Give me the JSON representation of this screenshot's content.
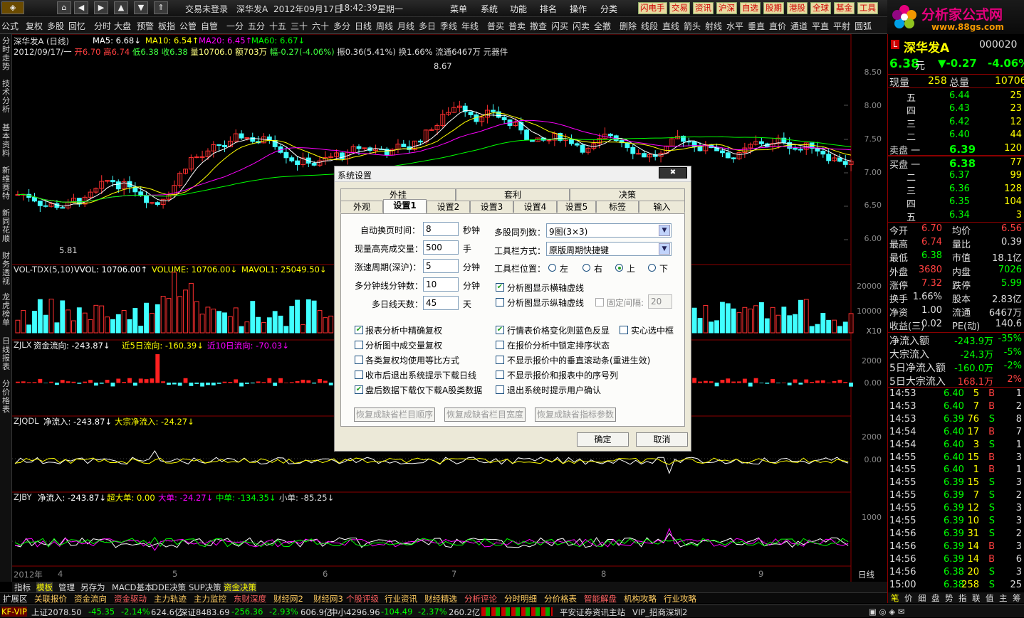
{
  "window": {
    "title_parts": [
      "交易未登录",
      "深华发A",
      "2012年09月17日",
      "18:42:39",
      "星期一"
    ],
    "menus": [
      "菜单",
      "系统",
      "功能",
      "排名",
      "操作",
      "分类"
    ],
    "quick_buttons": [
      "闪电手",
      "交易",
      "资讯",
      "沪深",
      "自选",
      "股期",
      "港股",
      "全球",
      "基金",
      "工具"
    ]
  },
  "logo": {
    "text": "分析家公式网",
    "url": "www.88gs.com"
  },
  "toolbar": [
    "公式",
    "复权",
    "多股",
    "回忆",
    "分时",
    "大盘",
    "预警",
    "板指",
    "公管",
    "自管",
    "一分",
    "五分",
    "十五",
    "三十",
    "六十",
    "多分",
    "日线",
    "周线",
    "月线",
    "多日",
    "季线",
    "年线",
    "普买",
    "普卖",
    "撤查",
    "闪买",
    "闪卖",
    "全撤",
    "删除",
    "线段",
    "直线",
    "箭头",
    "射线",
    "水平",
    "垂直",
    "直价",
    "通道",
    "平直",
    "平射",
    "圆弧"
  ],
  "leftbar": [
    "分时走势",
    "技术分析",
    "基本资料",
    "新维赛特",
    "新同花顺",
    "财务透视",
    "龙虎榜单",
    "日线报表",
    "分价格表"
  ],
  "chart": {
    "header1": "深华发A (日线) MA5: 6.68↓ MA10: 6.54↑ MA20: 6.45↑ MA60: 6.67↓",
    "header1_parts": {
      "name": "深华发A (日线)",
      "ma5": "MA5: 6.68↓",
      "ma10": "MA10: 6.54↑",
      "ma20": "MA20: 6.45↑",
      "ma60": "MA60: 6.67↓"
    },
    "header2_parts": {
      "date": "2012/09/17/一",
      "open": "开6.70",
      "high": "高6.74",
      "low": "低6.38",
      "close": "收6.38",
      "vol": "量10706.0",
      "amount": "额703万",
      "change": "幅-0.27(-4.06%)",
      "amp": "振0.36(5.41%)",
      "turnover": "换1.66%",
      "float": "流通6467万",
      "sector": "元器件"
    },
    "price_ticks": [
      "8.50",
      "8.00",
      "7.50",
      "7.00",
      "6.50",
      "6.00"
    ],
    "max_label": "8.67",
    "min_label": "5.81",
    "vol_header": {
      "name": "VOL-TDX(5,10)",
      "vvol": "VVOL: 10706.00↑",
      "volume": "VOLUME: 10706.00↓",
      "mavol": "MAVOL1: 25049.50↓"
    },
    "vol_ticks": [
      "20000",
      "10000"
    ],
    "vol_unit": "X10",
    "zjlx_header": {
      "name": "ZJLX",
      "a": "资金流向: -243.87↓",
      "b": "近5日流向: -160.39↓",
      "c": "近10日流向: -70.03↓"
    },
    "zjlx_ticks": [
      "2000",
      "0.00"
    ],
    "zjqdl_header": {
      "name": "ZJQDL",
      "a": "净流入: -243.87↓",
      "b": "大宗净流入: -24.27↓"
    },
    "zjqdl_ticks": [
      "2000",
      "0.00"
    ],
    "zjby_header": {
      "name": "ZJBY",
      "a": "净流入: -243.87↓",
      "b": "超大单: 0.00",
      "c": "大单: -24.27↓",
      "d": "中单: -134.35↓",
      "e": "小单: -85.25↓"
    },
    "zjby_ticks": [
      "1000"
    ],
    "xaxis": [
      "2012年",
      "4",
      "5",
      "6",
      "7",
      "8",
      "9"
    ],
    "period": "日线"
  },
  "quote": {
    "flag": "L",
    "name": "深华发A",
    "code": "000020",
    "price": "6.38",
    "unit": "元",
    "change": "▼-0.27",
    "pct": "-4.06%",
    "now_label": "现量",
    "now": "258",
    "total_label": "总量",
    "total": "10706",
    "sell": [
      {
        "l": "五",
        "p": "6.44",
        "v": "25"
      },
      {
        "l": "四",
        "p": "6.43",
        "v": "23"
      },
      {
        "l": "三",
        "p": "6.42",
        "v": "12"
      },
      {
        "l": "二",
        "p": "6.40",
        "v": "44"
      },
      {
        "l": "卖盘 一",
        "p": "6.39",
        "v": "120"
      }
    ],
    "buy": [
      {
        "l": "买盘 一",
        "p": "6.38",
        "v": "77"
      },
      {
        "l": "二",
        "p": "6.37",
        "v": "99"
      },
      {
        "l": "三",
        "p": "6.36",
        "v": "128"
      },
      {
        "l": "四",
        "p": "6.35",
        "v": "104"
      },
      {
        "l": "五",
        "p": "6.34",
        "v": "3"
      }
    ],
    "stats": [
      [
        "今开",
        "6.70",
        "均价",
        "6.56"
      ],
      [
        "最高",
        "6.74",
        "量比",
        "0.39"
      ],
      [
        "最低",
        "6.38",
        "市值",
        "18.1亿"
      ],
      [
        "外盘",
        "3680",
        "内盘",
        "7026"
      ],
      [
        "涨停",
        "7.32",
        "跌停",
        "5.99"
      ],
      [
        "换手",
        "1.66%",
        "股本",
        "2.83亿"
      ],
      [
        "净资",
        "1.00",
        "流通",
        "6467万"
      ],
      [
        "收益(三)",
        "0.02",
        "PE(动)",
        "140.6"
      ]
    ],
    "flows": [
      [
        "净流入额",
        "-243.9万",
        "-35%"
      ],
      [
        "大宗流入",
        "-24.3万",
        "-5%"
      ],
      [
        "5日净流入额",
        "-160.0万",
        "-2%"
      ],
      [
        "5日大宗流入",
        "168.1万",
        "2%"
      ]
    ],
    "ticks": [
      [
        "14:53",
        "6.40",
        "5",
        "B",
        "1"
      ],
      [
        "14:53",
        "6.40",
        "7",
        "B",
        "2"
      ],
      [
        "14:53",
        "6.39",
        "76",
        "S",
        "8"
      ],
      [
        "14:54",
        "6.40",
        "17",
        "B",
        "7"
      ],
      [
        "14:54",
        "6.40",
        "3",
        "S",
        "1"
      ],
      [
        "14:55",
        "6.40",
        "15",
        "B",
        "3"
      ],
      [
        "14:55",
        "6.40",
        "1",
        "B",
        "1"
      ],
      [
        "14:55",
        "6.39",
        "15",
        "S",
        "3"
      ],
      [
        "14:55",
        "6.39",
        "7",
        "S",
        "2"
      ],
      [
        "14:55",
        "6.39",
        "12",
        "S",
        "3"
      ],
      [
        "14:55",
        "6.39",
        "10",
        "S",
        "3"
      ],
      [
        "14:56",
        "6.39",
        "31",
        "S",
        "2"
      ],
      [
        "14:56",
        "6.39",
        "14",
        "B",
        "3"
      ],
      [
        "14:56",
        "6.39",
        "14",
        "B",
        "6"
      ],
      [
        "14:56",
        "6.38",
        "20",
        "S",
        "3"
      ],
      [
        "15:00",
        "6.38",
        "258",
        "S",
        "25"
      ]
    ],
    "bottom_tabs": [
      "笔",
      "价",
      "细",
      "盘",
      "势",
      "指",
      "联",
      "值",
      "主",
      "筹"
    ]
  },
  "dialog": {
    "title": "系统设置",
    "close": "✖",
    "tabs_row1": [
      "外挂",
      "套利",
      "决策"
    ],
    "tabs_row2": [
      "外观",
      "设置1",
      "设置2",
      "设置3",
      "设置4",
      "设置5",
      "标签",
      "输入"
    ],
    "fields": [
      {
        "label": "自动换页时间：",
        "value": "8",
        "unit": "秒钟"
      },
      {
        "label": "现量高亮成交量：",
        "value": "500",
        "unit": "手"
      },
      {
        "label": "涨速周期(深沪)：",
        "value": "5",
        "unit": "分钟"
      },
      {
        "label": "多分钟线分钟数：",
        "value": "10",
        "unit": "分钟"
      },
      {
        "label": "多日线天数：",
        "value": "45",
        "unit": "天"
      }
    ],
    "multi_label": "多股同列数：",
    "multi_value": "9图(3×3)",
    "tb_label": "工具栏方式：",
    "tb_value": "原版周期快捷键",
    "pos_label": "工具栏位置：",
    "pos_opts": [
      "左",
      "右",
      "上",
      "下"
    ],
    "chk_h": "分析图显示横轴虚线",
    "chk_v": "分析图显示纵轴虚线",
    "fixed_label": "固定间隔:",
    "fixed_value": "20",
    "left_checks": [
      {
        "t": "报表分析中精确复权",
        "c": true
      },
      {
        "t": "分析图中成交量复权",
        "c": false
      },
      {
        "t": "各类复权均使用等比方式",
        "c": false
      },
      {
        "t": "收市后退出系统提示下载日线",
        "c": false
      },
      {
        "t": "盘后数据下载仅下载A股类数据",
        "c": true
      }
    ],
    "right_checks": [
      {
        "t": "行情表价格变化则蓝色反显",
        "c": true
      },
      {
        "t": "在报价分析中锁定排序状态",
        "c": false
      },
      {
        "t": "不显示报价中的垂直滚动条(重进生效)",
        "c": false
      },
      {
        "t": "不显示报价和报表中的序号列",
        "c": false
      },
      {
        "t": "退出系统时提示用户确认",
        "c": false
      }
    ],
    "solid_check": "实心选中框",
    "restore_buttons": [
      "恢复成缺省栏目顺序",
      "恢复成缺省栏目宽度",
      "恢复成缺省指标参数"
    ],
    "ok": "确定",
    "cancel": "取消"
  },
  "bottom_tabs": [
    "指标",
    "模板",
    "管理",
    "另存为",
    "MACD基本",
    "DDE决策",
    "SUP决策",
    "资金决策"
  ],
  "categories": [
    "扩展区",
    "关联报价",
    "资金流向",
    "资金驱动",
    "主力轨迹",
    "主力监控",
    "东财深度",
    "财经网2",
    "财经网3",
    "个股评级",
    "行业资讯",
    "财经精选",
    "分析评论",
    "分时明细",
    "分价格表",
    "智能解盘",
    "机构攻略",
    "行业攻略"
  ],
  "status": {
    "vip": "KF-VIP",
    "sh": "上证2078.50",
    "sh_chg": "-45.35",
    "sh_pct": "-2.14%",
    "sh_amt": "624.6亿",
    "sz": "深证8483.69",
    "sz_chg": "-256.36",
    "sz_pct": "-2.93%",
    "sz_amt": "606.9亿",
    "zx": "中小4296.96",
    "zx_chg": "-104.49",
    "zx_pct": "-2.37%",
    "zx_amt": "260.2亿",
    "broker": "平安证券资讯主站",
    "site": "VIP_招商深圳2"
  }
}
